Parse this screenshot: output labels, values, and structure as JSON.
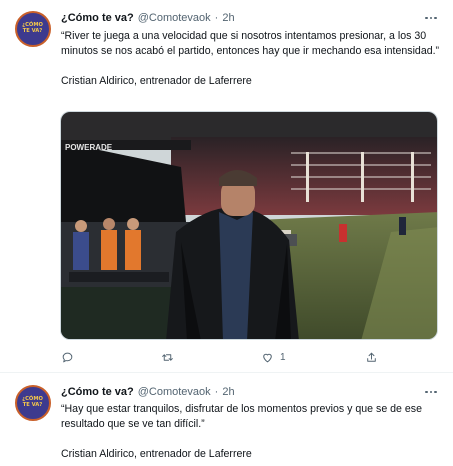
{
  "tweets": [
    {
      "avatar_text": "¿CÓMO TE VA?",
      "display_name": "¿Cómo te va?",
      "handle": "@Comotevaok",
      "separator": "·",
      "time": "2h",
      "quote": "“River te juega a una velocidad que si nosotros intentamos presionar, a los 30 minutos se nos acabó el partido, entonces hay que ir mechando esa intensidad.”",
      "attribution": "Cristian Aldirico, entrenador de Laferrere",
      "media_banner_text": "POWERADE",
      "likes": "1",
      "icons": [
        "reply-icon",
        "retweet-icon",
        "like-icon",
        "share-icon",
        "more-icon"
      ]
    },
    {
      "avatar_text": "¿CÓMO TE VA?",
      "display_name": "¿Cómo te va?",
      "handle": "@Comotevaok",
      "separator": "·",
      "time": "2h",
      "quote": "“Hay que estar tranquilos, disfrutar de los momentos previos y que se de ese resultado que se ve tan difícil.”",
      "attribution": "Cristian Aldirico, entrenador de Laferrere"
    }
  ],
  "colors": {
    "text": "#0f1419",
    "secondary": "#536471",
    "avatar_bg": "#3d3a8e",
    "avatar_ring": "#c9602a",
    "avatar_text": "#f4c84a"
  }
}
